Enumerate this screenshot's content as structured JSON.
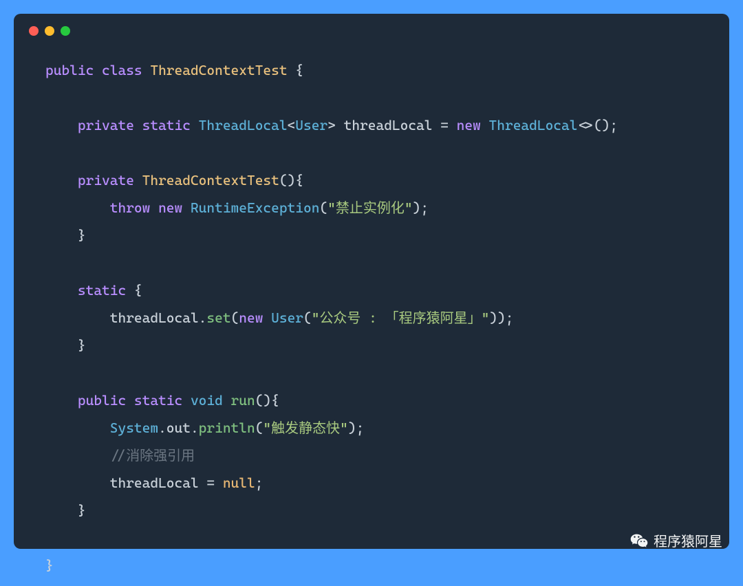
{
  "window": {
    "language": "java"
  },
  "code": {
    "class_name": "ThreadContextTest",
    "field_type": "ThreadLocal",
    "field_generic": "User",
    "field_name": "threadLocal",
    "ctor_throw_type": "RuntimeException",
    "ctor_throw_msg": "\"禁止实例化\"",
    "static_init_user_arg": "\"公众号 : 「程序猿阿星」\"",
    "run_println_arg": "\"触发静态快\"",
    "run_comment": "//消除强引用",
    "run_assign_value": "null",
    "kw": {
      "public": "public",
      "private": "private",
      "static": "static",
      "class": "class",
      "void": "void",
      "throw": "throw",
      "new": "new"
    },
    "types": {
      "ThreadLocal": "ThreadLocal",
      "User": "User",
      "RuntimeException": "RuntimeException",
      "System": "System"
    },
    "idents": {
      "out": "out",
      "println": "println",
      "set": "set",
      "run": "run"
    }
  },
  "watermark": {
    "text": "程序猿阿星"
  }
}
